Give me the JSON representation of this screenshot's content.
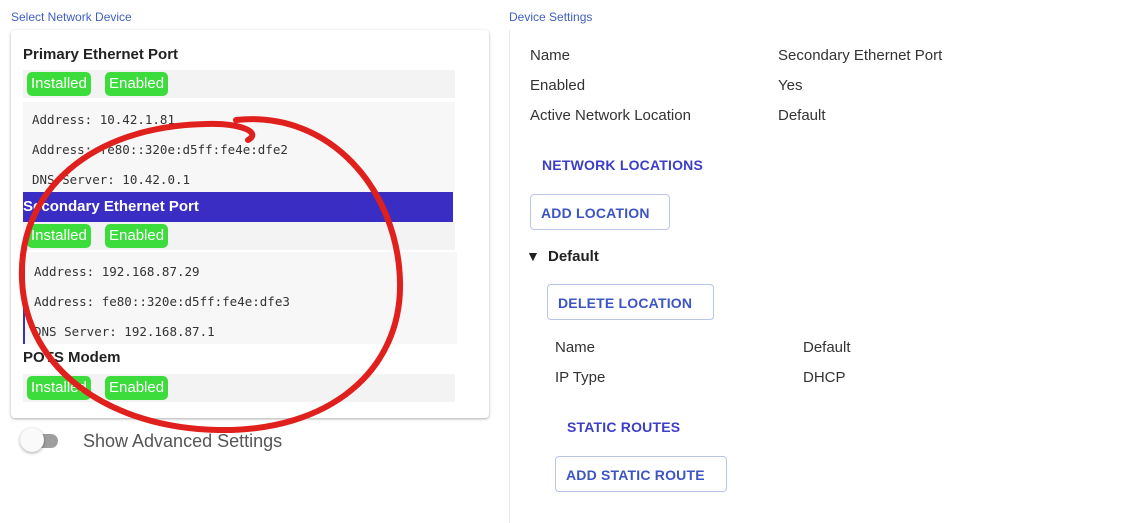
{
  "left": {
    "title": "Select Network Device",
    "devices": [
      {
        "name": "Primary Ethernet Port",
        "badges": [
          "Installed",
          "Enabled"
        ],
        "details": [
          "Address: 10.42.1.81",
          "Address: fe80::320e:d5ff:fe4e:dfe2",
          "DNS Server: 10.42.0.1"
        ]
      },
      {
        "name": "Secondary Ethernet Port",
        "badges": [
          "Installed",
          "Enabled"
        ],
        "details": [
          "Address: 192.168.87.29",
          "Address: fe80::320e:d5ff:fe4e:dfe3",
          "DNS Server: 192.168.87.1"
        ]
      },
      {
        "name": "POTS Modem",
        "badges": [
          "Installed",
          "Enabled"
        ],
        "details": []
      }
    ],
    "advanced_toggle": {
      "label": "Show Advanced Settings",
      "on": false
    }
  },
  "right": {
    "title": "Device Settings",
    "props": [
      {
        "key": "Name",
        "value": "Secondary Ethernet Port"
      },
      {
        "key": "Enabled",
        "value": "Yes"
      },
      {
        "key": "Active Network Location",
        "value": "Default"
      }
    ],
    "network_locations_heading": "NETWORK LOCATIONS",
    "add_location_label": "ADD LOCATION",
    "location": {
      "caret": "▼",
      "name": "Default",
      "delete_label": "DELETE LOCATION",
      "props": [
        {
          "key": "Name",
          "value": "Default"
        },
        {
          "key": "IP Type",
          "value": "DHCP"
        }
      ],
      "static_routes_heading": "STATIC ROUTES",
      "add_route_label": "ADD STATIC ROUTE"
    }
  },
  "colors": {
    "accent": "#3d55c4",
    "selected": "#3a2dc4",
    "badge": "#3ddc3d",
    "annotation": "#e0201c"
  }
}
